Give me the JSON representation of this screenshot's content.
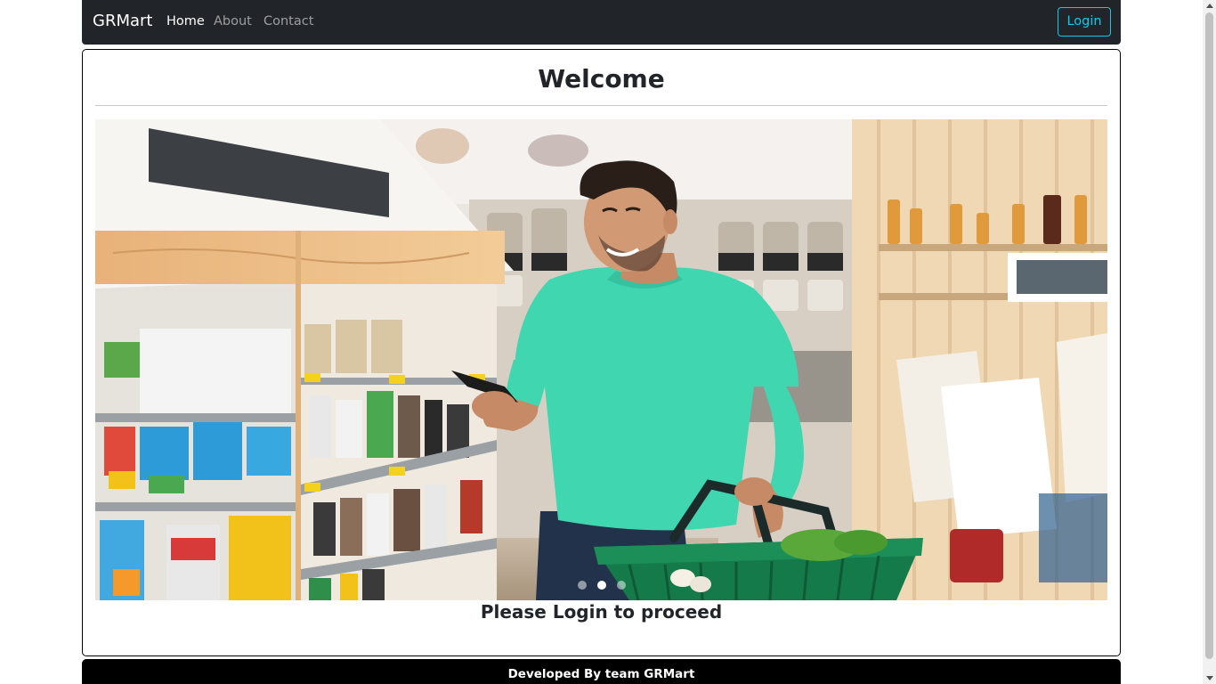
{
  "navbar": {
    "brand": "GRMart",
    "links": [
      {
        "label": "Home",
        "active": true
      },
      {
        "label": "About",
        "active": false
      },
      {
        "label": "Contact",
        "active": false
      }
    ],
    "login_label": "Login"
  },
  "main": {
    "title": "Welcome",
    "hero_image": "grocery-shopper-with-phone-and-basket",
    "carousel": {
      "slide_count": 3,
      "active_index": 1
    },
    "proceed_text": "Please Login to proceed"
  },
  "footer": {
    "text": "Developed By team GRMart"
  },
  "colors": {
    "navbar_bg": "#212529",
    "login_accent": "#0dcaf0",
    "footer_bg": "#000000",
    "shirt": "#3fd6b0",
    "basket": "#157a4a"
  }
}
